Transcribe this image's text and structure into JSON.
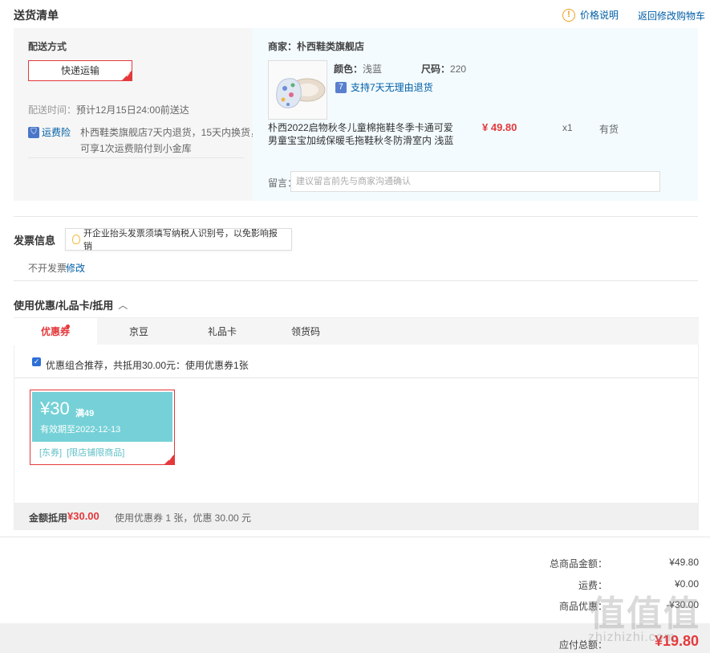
{
  "header": {
    "title": "送货清单",
    "price_info": "价格说明",
    "back_to_cart": "返回修改购物车"
  },
  "delivery": {
    "method_title": "配送方式",
    "method_button": "快递运输",
    "time_label": "配送时间：",
    "time_value": "预计12月15日24:00前送达",
    "insurance_label": "运费险",
    "insurance_text_1": "朴西鞋类旗舰店7天内退货，15天内换货，",
    "insurance_text_2": "可享1次运费赔付到小金库"
  },
  "merchant": {
    "label": "商家：",
    "name": "朴西鞋类旗舰店",
    "color_label": "颜色：",
    "color_value": "浅蓝",
    "size_label": "尺码：",
    "size_value": "220",
    "return_policy": "支持7天无理由退货",
    "product_name_1": "朴西2022启物秋冬儿童棉拖鞋冬季卡通可爱",
    "product_name_2": "男童宝宝加绒保暖毛拖鞋秋冬防滑室内 浅蓝",
    "price": "¥ 49.80",
    "quantity": "x1",
    "stock": "有货",
    "message_label": "留言：",
    "message_placeholder": "建议留言前先与商家沟通确认"
  },
  "invoice": {
    "title": "发票信息",
    "tip": "开企业抬头发票须填写纳税人识别号，以免影响报销",
    "status": "不开发票",
    "modify": "修改"
  },
  "discount": {
    "title": "使用优惠/礼品卡/抵用",
    "tabs": [
      "优惠券",
      "京豆",
      "礼品卡",
      "领货码"
    ],
    "recommend_text": "优惠组合推荐，共抵用30.00元：使用优惠券1张",
    "coupon": {
      "amount": "¥30",
      "condition": "满49",
      "validity": "有效期至2022-12-13",
      "tags": "[东券]  [限店铺限商品]"
    },
    "summary_label": "金额抵用",
    "summary_amount": "¥30.00",
    "summary_text": "使用优惠券 1 张，优惠 30.00 元"
  },
  "totals": {
    "goods_label": "总商品金额：",
    "goods_value": "¥49.80",
    "shipping_label": "运费：",
    "shipping_value": "¥0.00",
    "discount_label": "商品优惠：",
    "discount_value": "-¥30.00",
    "payable_label": "应付总额：",
    "payable_value": "¥19.80"
  },
  "watermark": {
    "main": "值值值",
    "sub": "zhizhizhi.com"
  }
}
